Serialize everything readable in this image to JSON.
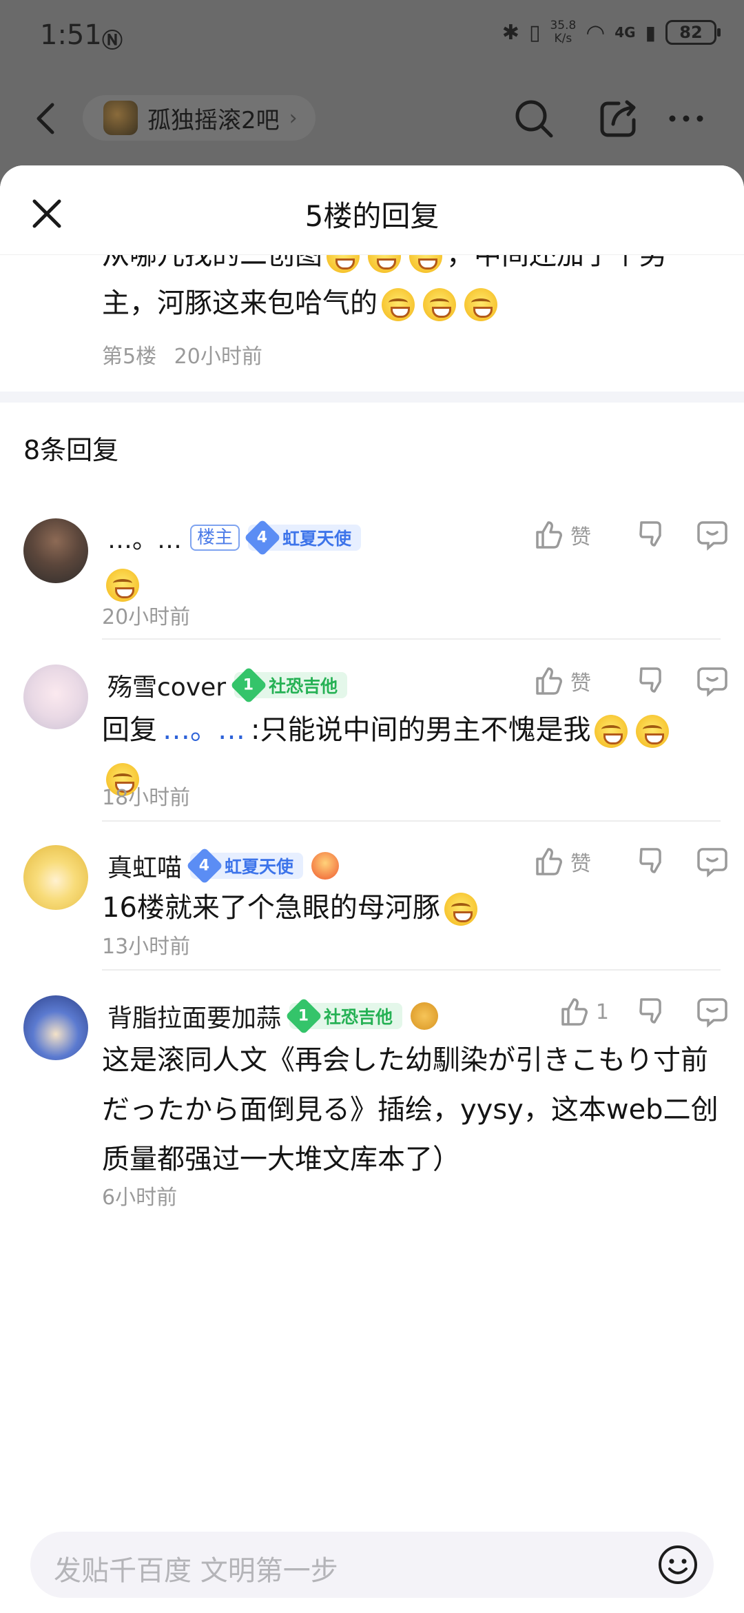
{
  "status_bar": {
    "time": "1:51",
    "speed_top": "35.8",
    "speed_unit": "K/s",
    "network": "4G",
    "battery": "82"
  },
  "top_nav": {
    "forum_name": "孤独摇滚2吧"
  },
  "sheet": {
    "title": "5楼的回复"
  },
  "floor": {
    "text_line1": "从哪儿找的二创图",
    "text_line1_tail": "，中间还加了个男",
    "text_line2": "主，河豚这来包哈气的",
    "floor_label": "第5楼",
    "time": "20小时前"
  },
  "reply_count": "8条回复",
  "replies": [
    {
      "username": "…。…",
      "op_badge": "楼主",
      "level": "4",
      "level_title": "虹夏天使",
      "like_label": "赞",
      "body": "",
      "time": "20小时前"
    },
    {
      "username": "殇雪cover",
      "level": "1",
      "level_title": "社恐吉他",
      "like_label": "赞",
      "body_prefix": "回复",
      "reply_to": "…。…",
      "body": ":只能说中间的男主不愧是我",
      "time": "18小时前"
    },
    {
      "username": "真虹喵",
      "level": "4",
      "level_title": "虹夏天使",
      "like_label": "赞",
      "body": "16楼就来了个急眼的母河豚",
      "time": "13小时前"
    },
    {
      "username": "背脂拉面要加蒜",
      "level": "1",
      "level_title": "社恐吉他",
      "like_label": "1",
      "body": "这是滚同人文《再会した幼馴染が引きこもり寸前だったから面倒見る》插绘，yysy，这本web二创质量都强过一大堆文库本了）",
      "time": "6小时前"
    }
  ],
  "bottom": {
    "input_placeholder": "发贴千百度 文明第一步"
  },
  "colors": {
    "accent_blue": "#3d74ea",
    "accent_green": "#25b154",
    "meta_gray": "#9a9a9a"
  }
}
